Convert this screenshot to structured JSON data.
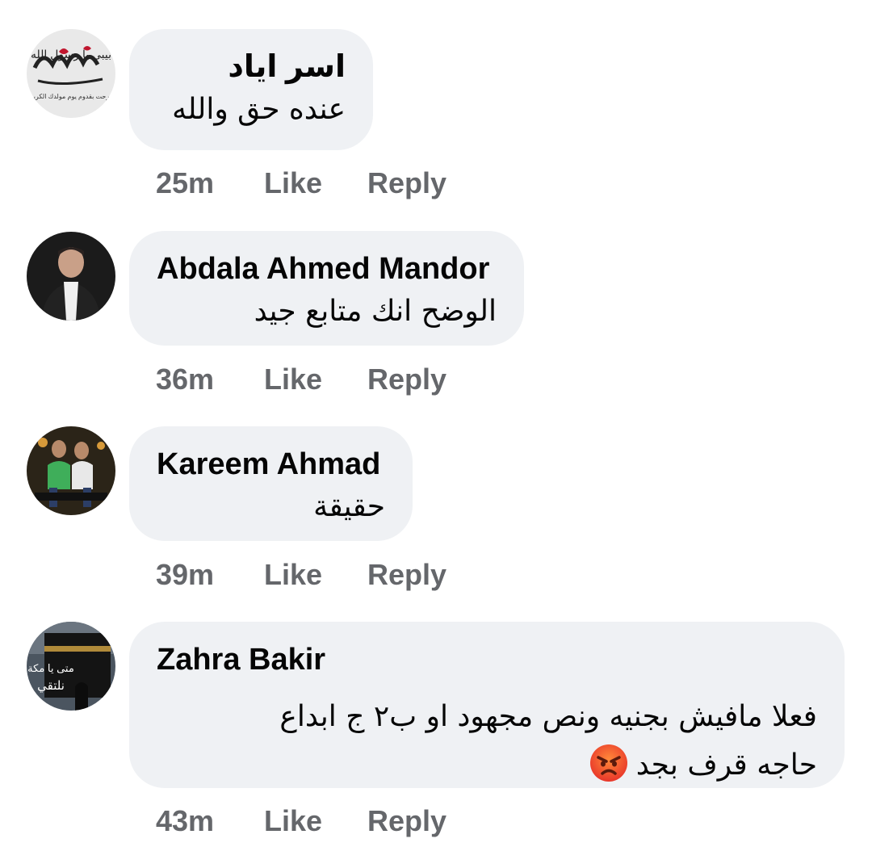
{
  "comments": [
    {
      "author": "اسر اياد",
      "lines": [
        "عنده حق والله"
      ],
      "time": "25m",
      "like_label": "Like",
      "reply_label": "Reply",
      "avatar_text": [
        "بيبي يا رسول الله",
        "فرحت بقدوم يوم مولدك الكريم"
      ]
    },
    {
      "author": "Abdala Ahmed Mandor",
      "lines": [
        "الوضح انك متابع جيد"
      ],
      "time": "36m",
      "like_label": "Like",
      "reply_label": "Reply"
    },
    {
      "author": "Kareem Ahmad",
      "lines": [
        "حقيقة"
      ],
      "time": "39m",
      "like_label": "Like",
      "reply_label": "Reply"
    },
    {
      "author": "Zahra Bakir",
      "lines": [
        "فعلا مافيش بجنيه ونص مجهود او ب٢ ج ابداع",
        "حاجه قرف بجد"
      ],
      "emoji": "angry-face",
      "time": "43m",
      "like_label": "Like",
      "reply_label": "Reply",
      "avatar_text": [
        "متى يا مكة",
        "نلتقي"
      ]
    }
  ],
  "colors": {
    "bubble": "#eff1f4",
    "text": "#050505",
    "meta": "#65676b"
  }
}
